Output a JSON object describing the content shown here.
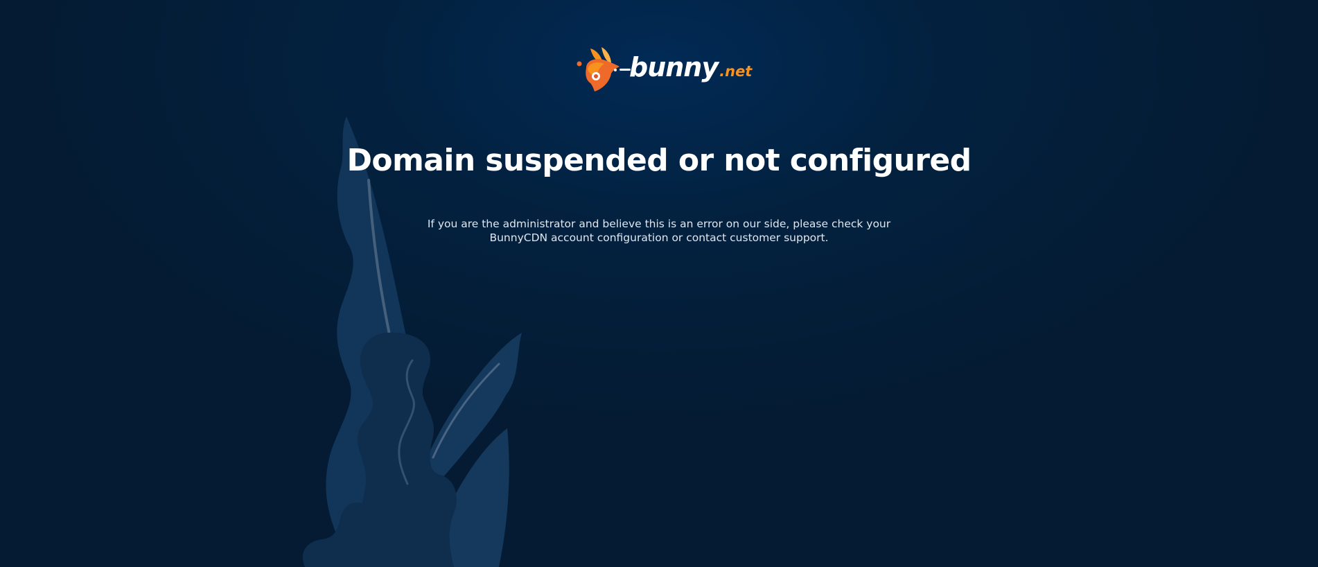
{
  "brand": {
    "name": "bunny",
    "tld": ".net",
    "accent_color": "#f7921e",
    "logo_icon": "bunny-logo-icon"
  },
  "page": {
    "title": "Domain suspended or not configured",
    "message": "If you are the administrator and believe this is an error on our side, please check your BunnyCDN account configuration or contact customer support."
  },
  "colors": {
    "background": "#03213f",
    "text": "#ffffff",
    "decor_leaf": "#15395c"
  }
}
